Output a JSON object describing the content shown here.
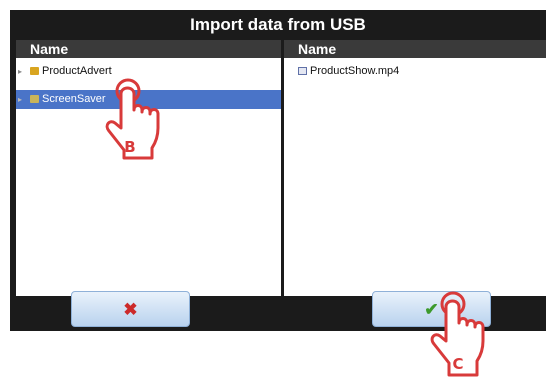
{
  "dialog": {
    "title": "Import data from USB",
    "left_pane": {
      "header": "Name",
      "items": [
        {
          "label": "ProductAdvert",
          "icon": "folder-icon",
          "selected": false
        },
        {
          "label": "ScreenSaver",
          "icon": "folder-icon",
          "selected": true
        }
      ]
    },
    "right_pane": {
      "header": "Name",
      "items": [
        {
          "label": "ProductShow.mp4",
          "icon": "video-file-icon"
        }
      ]
    },
    "buttons": {
      "cancel_icon": "close-icon",
      "confirm_icon": "checkmark-icon"
    }
  },
  "callouts": {
    "b": "B",
    "c": "C"
  },
  "colors": {
    "dialog_bg": "#1b1b1b",
    "header_bg": "#3a3a3a",
    "selection": "#4a74c8",
    "button_bg": "#c9dcf2",
    "cancel_x": "#cc2a2a",
    "confirm_check": "#3d9a2c",
    "callout": "#d83a3a"
  }
}
